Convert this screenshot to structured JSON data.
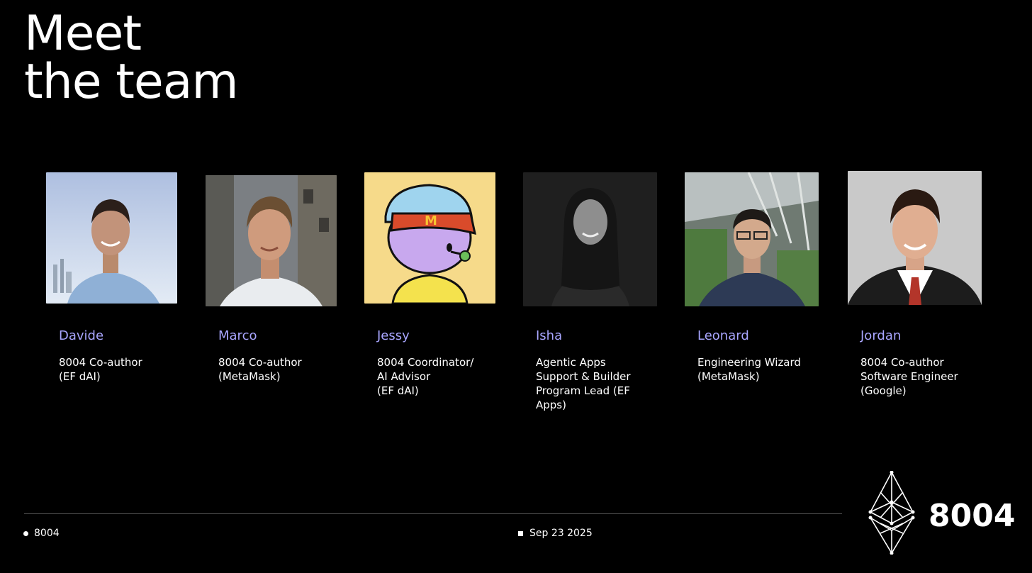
{
  "slide": {
    "title_line1": "Meet",
    "title_line2": "the team"
  },
  "members": [
    {
      "name": "Davide",
      "role": [
        "8004 Co-author",
        "(EF dAI)"
      ]
    },
    {
      "name": "Marco",
      "role": [
        "8004 Co-author",
        "(MetaMask)"
      ]
    },
    {
      "name": "Jessy",
      "role": [
        "8004 Coordinator/",
        "AI Advisor",
        "(EF dAI)"
      ]
    },
    {
      "name": "Isha",
      "role": [
        "Agentic Apps",
        "Support & Builder",
        "Program Lead (EF",
        "Apps)"
      ]
    },
    {
      "name": "Leonard",
      "role": [
        "Engineering Wizard",
        "(MetaMask)"
      ]
    },
    {
      "name": "Jordan",
      "role": [
        "8004 Co-author",
        "Software Engineer",
        "(Google)"
      ]
    }
  ],
  "footer": {
    "left_label": "8004",
    "date": "Sep 23  2025"
  },
  "brand": {
    "text": "8004",
    "icon": "ethereum-diamond-icon"
  },
  "colors": {
    "background": "#000000",
    "name_accent": "#a9a6ff",
    "text": "#ffffff"
  }
}
